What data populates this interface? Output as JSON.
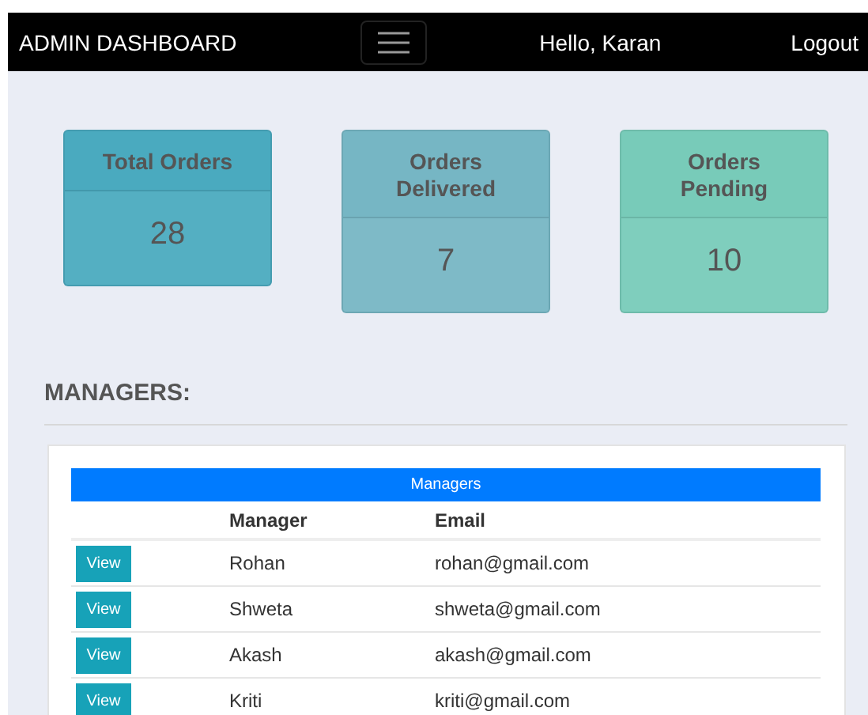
{
  "navbar": {
    "title": "ADMIN DASHBOARD",
    "greeting": "Hello, Karan",
    "logout": "Logout"
  },
  "stats": [
    {
      "label": "Total Orders",
      "value": "28",
      "color": "#4aaabf"
    },
    {
      "label": "Orders Delivered",
      "value": "7",
      "color": "#76b6c4"
    },
    {
      "label": "Orders Pending",
      "value": "10",
      "color": "#78cbb9"
    }
  ],
  "section_title": "MANAGERS:",
  "table": {
    "caption": "Managers",
    "columns": [
      "Manager",
      "Email"
    ],
    "rows": [
      {
        "action": "View",
        "name": "Rohan",
        "email": "rohan@gmail.com"
      },
      {
        "action": "View",
        "name": "Shweta",
        "email": "shweta@gmail.com"
      },
      {
        "action": "View",
        "name": "Akash",
        "email": "akash@gmail.com"
      },
      {
        "action": "View",
        "name": "Kriti",
        "email": "kriti@gmail.com"
      }
    ]
  }
}
